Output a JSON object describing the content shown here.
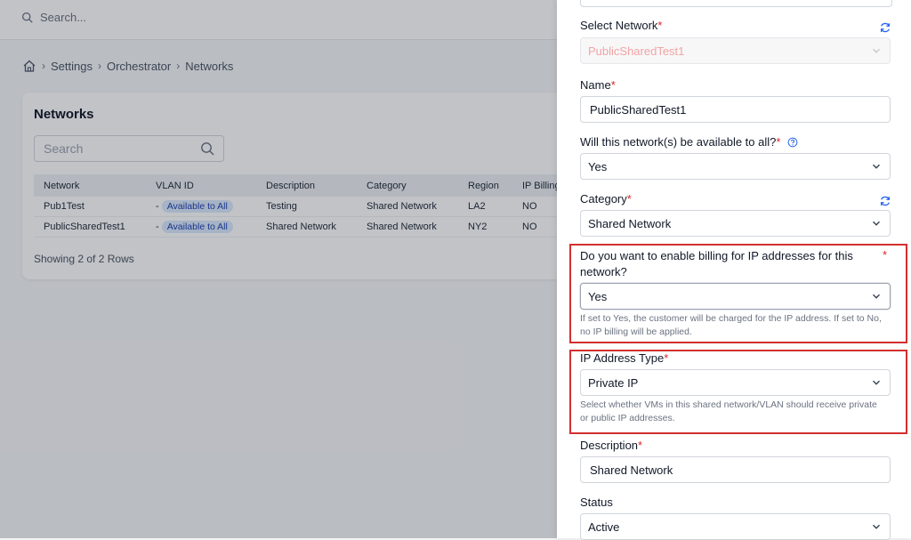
{
  "topbar": {
    "search_placeholder": "Search..."
  },
  "breadcrumb": {
    "items": [
      "Settings",
      "Orchestrator",
      "Networks"
    ]
  },
  "networks_card": {
    "title": "Networks",
    "search_placeholder": "Search",
    "columns": [
      "Network",
      "VLAN ID",
      "Description",
      "Category",
      "Region",
      "IP Billing"
    ],
    "rows": [
      {
        "network": "Pub1Test",
        "vlan_prefix": "-",
        "vlan": "Available to All",
        "description": "Testing",
        "category": "Shared Network",
        "region": "LA2",
        "ip_billing": "NO"
      },
      {
        "network": "PublicSharedTest1",
        "vlan_prefix": "-",
        "vlan": "Available to All",
        "description": "Shared Network",
        "category": "Shared Network",
        "region": "NY2",
        "ip_billing": "NO"
      }
    ],
    "rows_count": "Showing 2 of 2 Rows"
  },
  "form": {
    "select_network": {
      "label": "Select Network",
      "required": "*",
      "value": "PublicSharedTest1"
    },
    "name": {
      "label": "Name",
      "required": "*",
      "value": "PublicSharedTest1"
    },
    "available_to_all": {
      "label": "Will this network(s) be available to all?",
      "required": "*",
      "value": "Yes"
    },
    "category": {
      "label": "Category",
      "required": "*",
      "value": "Shared Network"
    },
    "billing": {
      "label": "Do you want to enable billing for IP addresses for this network?",
      "required": "*",
      "value": "Yes",
      "help": "If set to Yes, the customer will be charged for the IP address. If set to No, no IP billing will be applied."
    },
    "ip_address_type": {
      "label": "IP Address Type",
      "required": "*",
      "value": "Private IP",
      "help": "Select whether VMs in this shared network/VLAN should receive private or public IP addresses."
    },
    "description": {
      "label": "Description",
      "required": "*",
      "value": "Shared Network"
    },
    "status": {
      "label": "Status",
      "value": "Active"
    }
  },
  "colors": {
    "highlight": "#d32f2f",
    "required": "#dc2626",
    "pill_bg": "#dbeafe"
  },
  "icons": [
    "search-icon",
    "home-icon",
    "chevron-right-icon",
    "chevron-down-icon",
    "refresh-icon",
    "help-circle-icon"
  ]
}
